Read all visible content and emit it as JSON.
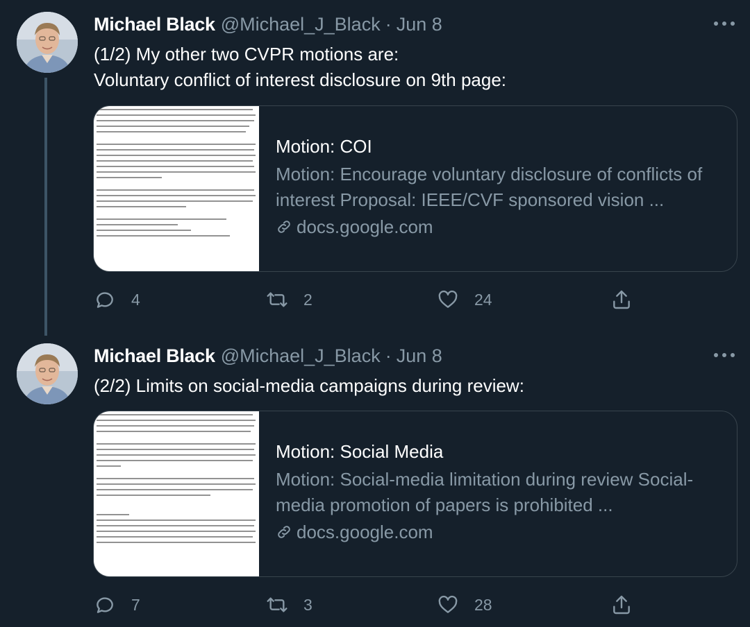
{
  "tweets": [
    {
      "author": {
        "name": "Michael Black",
        "handle": "@Michael_J_Black"
      },
      "dot": "·",
      "date": "Jun 8",
      "text_lines": [
        "(1/2) My other two CVPR motions are:",
        "Voluntary conflict of interest disclosure on 9th page:"
      ],
      "card": {
        "title": "Motion: COI",
        "description": "Motion: Encourage voluntary disclosure of conflicts of interest Proposal: IEEE/CVF sponsored vision ...",
        "domain": "docs.google.com",
        "thumbnail_icon": "document-preview-icon"
      },
      "stats": {
        "replies": "4",
        "retweets": "2",
        "likes": "24"
      }
    },
    {
      "author": {
        "name": "Michael Black",
        "handle": "@Michael_J_Black"
      },
      "dot": "·",
      "date": "Jun 8",
      "text_lines": [
        "(2/2) Limits on social-media campaigns during review:"
      ],
      "card": {
        "title": "Motion: Social Media",
        "description": "Motion: Social-media limitation during review Social-media promotion of papers is prohibited ...",
        "domain": "docs.google.com",
        "thumbnail_icon": "document-preview-icon"
      },
      "stats": {
        "replies": "7",
        "retweets": "3",
        "likes": "28"
      }
    }
  ],
  "icons": [
    "more-icon",
    "reply-icon",
    "retweet-icon",
    "like-icon",
    "share-icon",
    "link-icon"
  ],
  "colors": {
    "background": "#15202b",
    "muted": "#8899a6",
    "border": "#38444d",
    "text": "#ffffff"
  }
}
